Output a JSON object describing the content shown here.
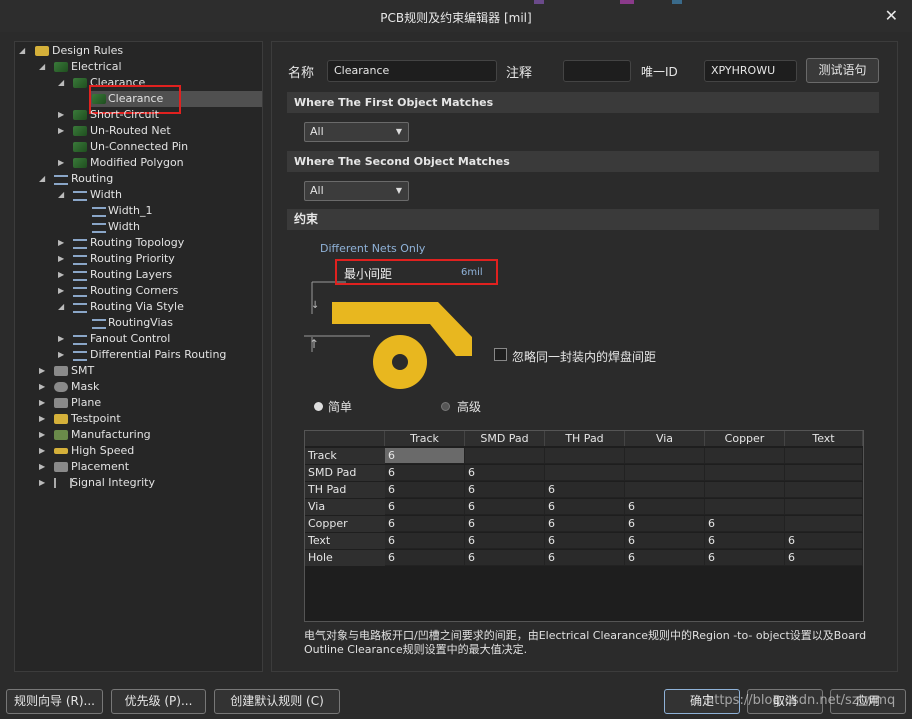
{
  "window": {
    "title": "PCB规则及约束编辑器 [mil]"
  },
  "tree": {
    "root": "Design Rules",
    "electrical": "Electrical",
    "clearance_group": "Clearance",
    "clearance_rule": "Clearance",
    "short_circuit": "Short-Circuit",
    "unrouted_net": "Un-Routed Net",
    "unconnected_pin": "Un-Connected Pin",
    "modified_polygon": "Modified Polygon",
    "routing": "Routing",
    "width": "Width",
    "width_1": "Width_1",
    "width_rule": "Width",
    "routing_topology": "Routing Topology",
    "routing_priority": "Routing Priority",
    "routing_layers": "Routing Layers",
    "routing_corners": "Routing Corners",
    "routing_via_style": "Routing Via Style",
    "routing_vias": "RoutingVias",
    "fanout_control": "Fanout Control",
    "diff_pairs_routing": "Differential Pairs Routing",
    "smt": "SMT",
    "mask": "Mask",
    "plane": "Plane",
    "testpoint": "Testpoint",
    "manufacturing": "Manufacturing",
    "high_speed": "High Speed",
    "placement": "Placement",
    "signal_integrity": "Signal Integrity"
  },
  "form": {
    "name_label": "名称",
    "name_value": "Clearance",
    "comment_label": "注释",
    "comment_value": "",
    "uid_label": "唯一ID",
    "uid_value": "XPYHROWU",
    "test_button": "测试语句"
  },
  "first_match": {
    "header": "Where The First Object Matches",
    "value": "All"
  },
  "second_match": {
    "header": "Where The Second Object Matches",
    "value": "All"
  },
  "constraints": {
    "header": "约束",
    "nets_scope": "Different Nets Only",
    "min_clearance_label": "最小间距",
    "min_clearance_value": "6mil",
    "ignore_pad_label": "忽略同一封装内的焊盘间距",
    "ignore_pad_checked": false,
    "mode_simple": "简单",
    "mode_advanced": "高级",
    "selected_mode": "简单"
  },
  "matrix": {
    "columns": [
      "Track",
      "SMD Pad",
      "TH Pad",
      "Via",
      "Copper",
      "Text"
    ],
    "rows": [
      {
        "label": "Track",
        "values": [
          "6"
        ]
      },
      {
        "label": "SMD Pad",
        "values": [
          "6",
          "6"
        ]
      },
      {
        "label": "TH Pad",
        "values": [
          "6",
          "6",
          "6"
        ]
      },
      {
        "label": "Via",
        "values": [
          "6",
          "6",
          "6",
          "6"
        ]
      },
      {
        "label": "Copper",
        "values": [
          "6",
          "6",
          "6",
          "6",
          "6"
        ]
      },
      {
        "label": "Text",
        "values": [
          "6",
          "6",
          "6",
          "6",
          "6",
          "6"
        ]
      },
      {
        "label": "Hole",
        "values": [
          "6",
          "6",
          "6",
          "6",
          "6",
          "6"
        ]
      }
    ]
  },
  "description": "电气对象与电路板开口/凹槽之间要求的间距，由Electrical Clearance规则中的Region -to- object设置以及Board Outline Clearance规则设置中的最大值决定.",
  "buttons": {
    "rule_wizard": "规则向导 (R)...",
    "priority": "优先级 (P)...",
    "create_default": "创建默认规则 (C)",
    "ok": "确定",
    "cancel": "取消",
    "apply": "应用"
  },
  "watermark": "https://blog.csdn.net/sztwmq",
  "colors": {
    "highlight_box": "#e0211f",
    "copper_yellow": "#e8b71f",
    "selection": "#505050"
  }
}
